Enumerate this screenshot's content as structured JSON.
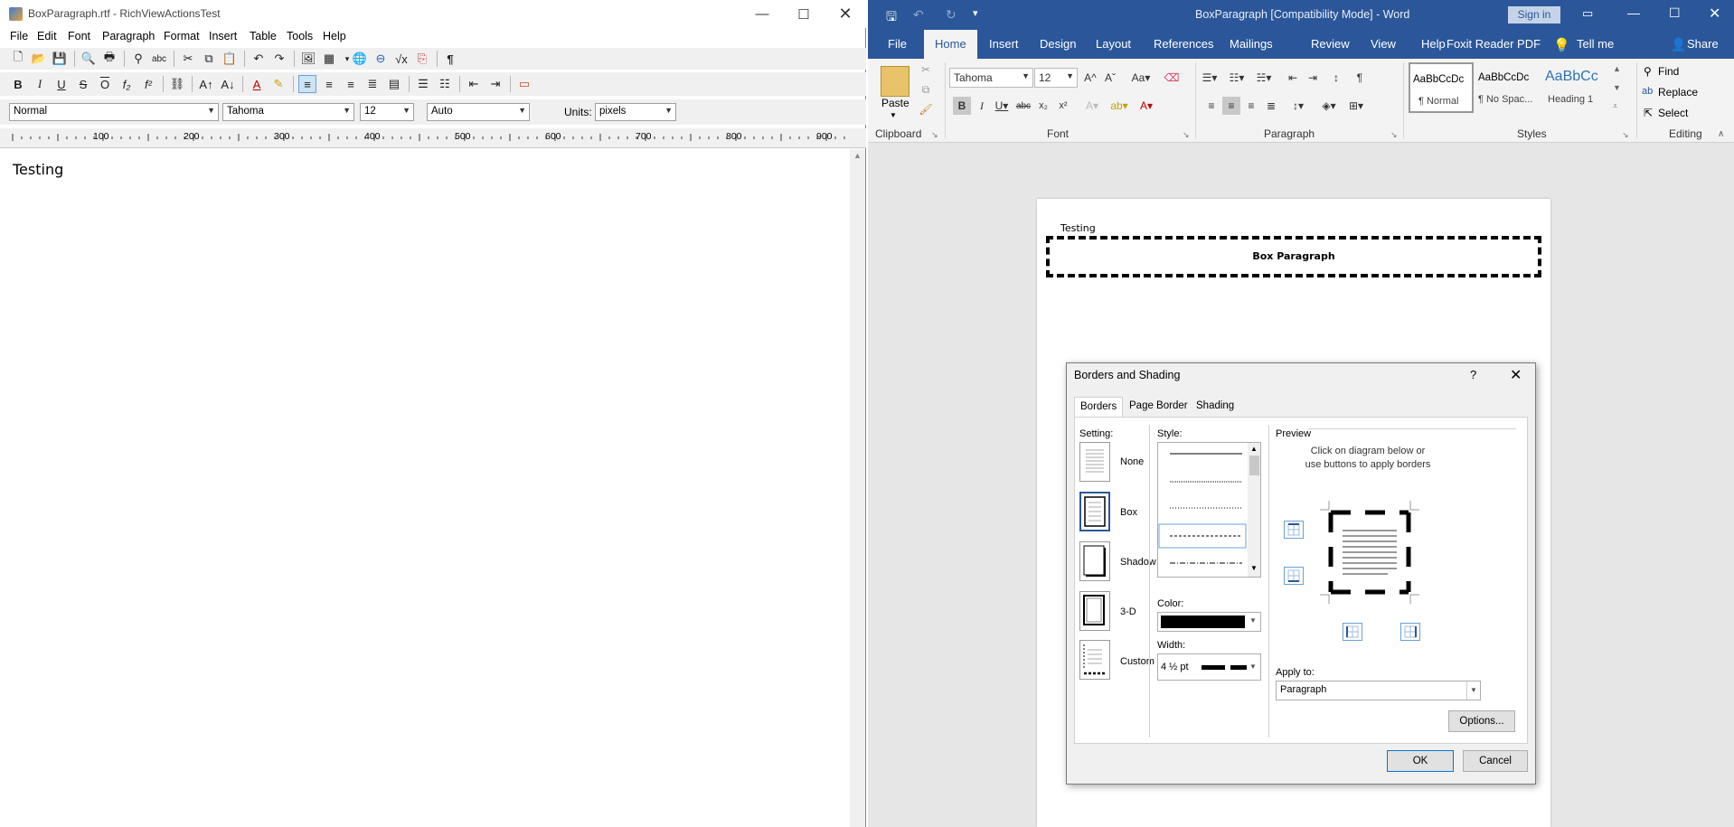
{
  "left_window": {
    "title": "BoxParagraph.rtf - RichViewActionsTest",
    "menu": [
      "File",
      "Edit",
      "Font",
      "Paragraph",
      "Format",
      "Insert",
      "Table",
      "Tools",
      "Help"
    ],
    "style_combo": "Normal",
    "font_combo": "Tahoma",
    "size_combo": "12",
    "color_combo": "Auto",
    "units_label": "Units:",
    "units_combo": "pixels",
    "ruler_marks": [
      "100",
      "200",
      "300",
      "400",
      "500",
      "600",
      "700",
      "800",
      "900"
    ],
    "document_text": "Testing"
  },
  "right_window": {
    "title": "BoxParagraph [Compatibility Mode] - Word",
    "sign_in": "Sign in",
    "tabs": [
      "File",
      "Home",
      "Insert",
      "Design",
      "Layout",
      "References",
      "Mailings",
      "Review",
      "View",
      "Help",
      "Foxit Reader PDF",
      "Tell me",
      "Share"
    ],
    "active_tab": "Home",
    "ribbon": {
      "paste": "Paste",
      "font_name": "Tahoma",
      "font_size": "12",
      "groups": [
        "Clipboard",
        "Font",
        "Paragraph",
        "Styles",
        "Editing"
      ],
      "styles": [
        {
          "preview": "AaBbCcDc",
          "name": "¶ Normal"
        },
        {
          "preview": "AaBbCcDc",
          "name": "¶ No Spac..."
        },
        {
          "preview": "AaBbCc",
          "name": "Heading 1"
        }
      ],
      "editing": [
        "Find",
        "Replace",
        "Select"
      ]
    },
    "page": {
      "line1": "Testing",
      "box_text": "Box Paragraph"
    }
  },
  "dialog": {
    "title": "Borders and Shading",
    "help": "?",
    "tabs": [
      "Borders",
      "Page Border",
      "Shading"
    ],
    "setting_label": "Setting:",
    "settings": [
      "None",
      "Box",
      "Shadow",
      "3-D",
      "Custom"
    ],
    "style_label": "Style:",
    "color_label": "Color:",
    "width_label": "Width:",
    "width_value": "4 ½ pt",
    "preview_label": "Preview",
    "preview_hint": "Click on diagram below or use buttons to apply borders",
    "apply_to_label": "Apply to:",
    "apply_to_value": "Paragraph",
    "options": "Options...",
    "ok": "OK",
    "cancel": "Cancel"
  }
}
